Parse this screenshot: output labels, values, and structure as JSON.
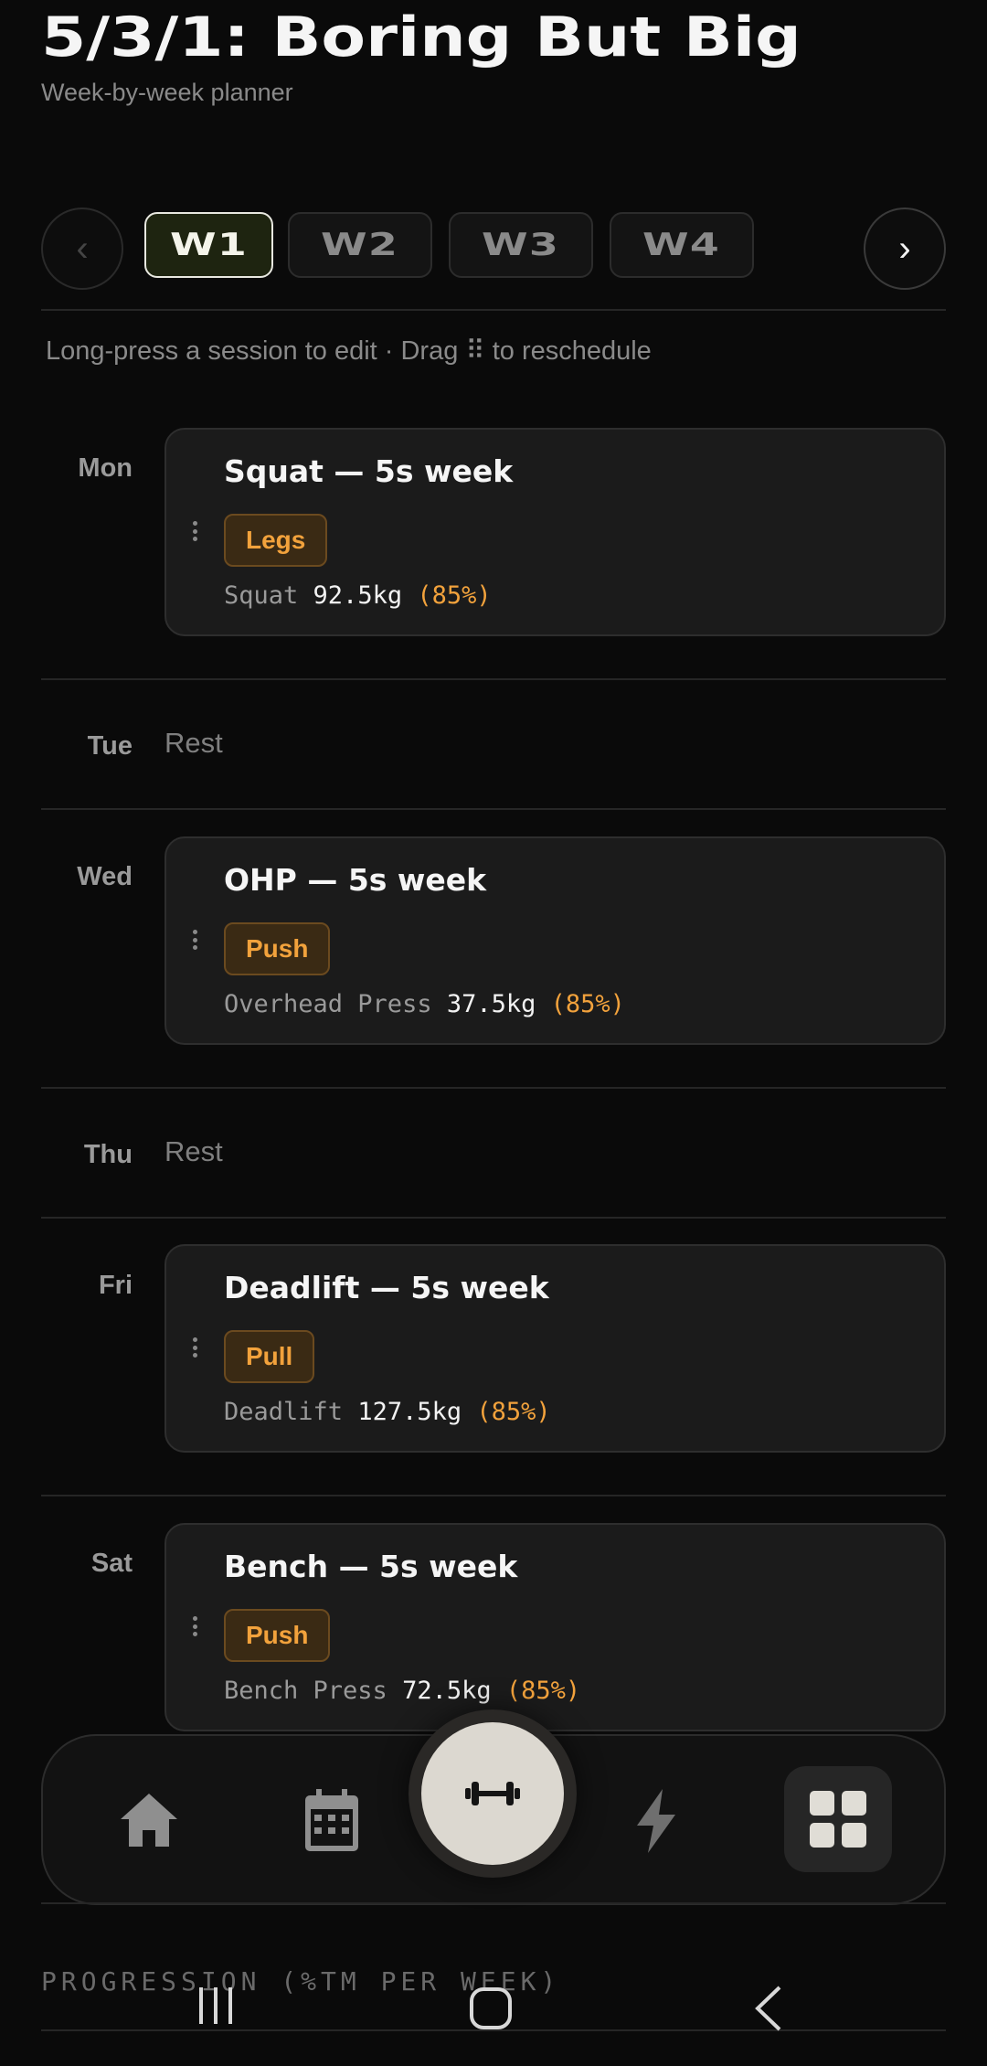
{
  "header": {
    "title": "5/3/1: Boring But Big",
    "subtitle": "Week-by-week planner"
  },
  "week_selector": {
    "prev_label": "‹",
    "next_label": "›",
    "tabs": [
      {
        "label": "W1",
        "active": true
      },
      {
        "label": "W2",
        "active": false
      },
      {
        "label": "W3",
        "active": false
      },
      {
        "label": "W4",
        "active": false
      }
    ]
  },
  "hint": "Long-press a session to edit · Drag ⠿ to reschedule",
  "days": [
    {
      "day": "Mon",
      "type": "session",
      "title": "Squat — 5s week",
      "tag": "Legs",
      "lift": "Squat",
      "weight": "92.5kg",
      "pct": "(85%)"
    },
    {
      "day": "Tue",
      "type": "rest",
      "rest_label": "Rest"
    },
    {
      "day": "Wed",
      "type": "session",
      "title": "OHP — 5s week",
      "tag": "Push",
      "lift": "Overhead Press",
      "weight": "37.5kg",
      "pct": "(85%)"
    },
    {
      "day": "Thu",
      "type": "rest",
      "rest_label": "Rest"
    },
    {
      "day": "Fri",
      "type": "session",
      "title": "Deadlift — 5s week",
      "tag": "Pull",
      "lift": "Deadlift",
      "weight": "127.5kg",
      "pct": "(85%)"
    },
    {
      "day": "Sat",
      "type": "session",
      "title": "Bench — 5s week",
      "tag": "Push",
      "lift": "Bench Press",
      "weight": "72.5kg",
      "pct": "(85%)"
    }
  ],
  "bottom_nav": {
    "items": [
      "home-icon",
      "calendar-icon",
      "dumbbell-icon",
      "bolt-icon",
      "grid-icon"
    ],
    "active": "grid-icon"
  },
  "progression_heading": "PROGRESSION (%TM PER WEEK)",
  "colors": {
    "background": "#0a0a0a",
    "accent_orange": "#f2a23c",
    "card": "#1b1b1b",
    "active_week": "#1e2410"
  }
}
